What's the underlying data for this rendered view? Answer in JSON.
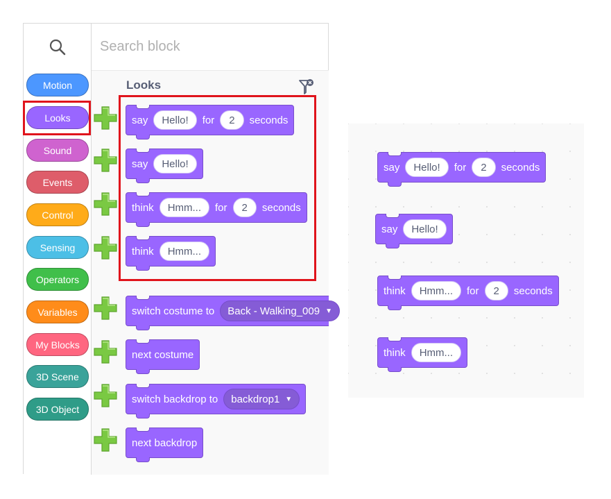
{
  "search": {
    "placeholder": "Search block",
    "icon": "search-icon"
  },
  "categories": [
    {
      "label": "Motion",
      "color": "#4c97ff"
    },
    {
      "label": "Looks",
      "color": "#9966ff"
    },
    {
      "label": "Sound",
      "color": "#cf63cf"
    },
    {
      "label": "Events",
      "color": "#de5d6a"
    },
    {
      "label": "Control",
      "color": "#ffab19"
    },
    {
      "label": "Sensing",
      "color": "#4cbfe6"
    },
    {
      "label": "Operators",
      "color": "#40bf4a"
    },
    {
      "label": "Variables",
      "color": "#ff8c1a"
    },
    {
      "label": "My Blocks",
      "color": "#ff6680"
    },
    {
      "label": "3D Scene",
      "color": "#3aa39a"
    },
    {
      "label": "3D Object",
      "color": "#2f9c88"
    }
  ],
  "selected_category": "Looks",
  "flyout": {
    "title": "Looks",
    "blocks": {
      "say_for": {
        "say": "say",
        "message": "Hello!",
        "for": "for",
        "secs": "2",
        "seconds": "seconds"
      },
      "say": {
        "say": "say",
        "message": "Hello!"
      },
      "think_for": {
        "think": "think",
        "message": "Hmm...",
        "for": "for",
        "secs": "2",
        "seconds": "seconds"
      },
      "think": {
        "think": "think",
        "message": "Hmm..."
      },
      "switch_costume": {
        "label": "switch costume to",
        "value": "Back - Walking_009"
      },
      "next_costume": {
        "label": "next costume"
      },
      "switch_backdrop": {
        "label": "switch backdrop to",
        "value": "backdrop1"
      },
      "next_backdrop": {
        "label": "next backdrop"
      }
    }
  },
  "workspace": {
    "say_for": {
      "say": "say",
      "message": "Hello!",
      "for": "for",
      "secs": "2",
      "seconds": "seconds"
    },
    "say": {
      "say": "say",
      "message": "Hello!"
    },
    "think_for": {
      "think": "think",
      "message": "Hmm...",
      "for": "for",
      "secs": "2",
      "seconds": "seconds"
    },
    "think": {
      "think": "think",
      "message": "Hmm..."
    }
  },
  "colors": {
    "looks_block": "#9966ff",
    "highlight": "#e0141c",
    "plus": "#7ac943"
  }
}
